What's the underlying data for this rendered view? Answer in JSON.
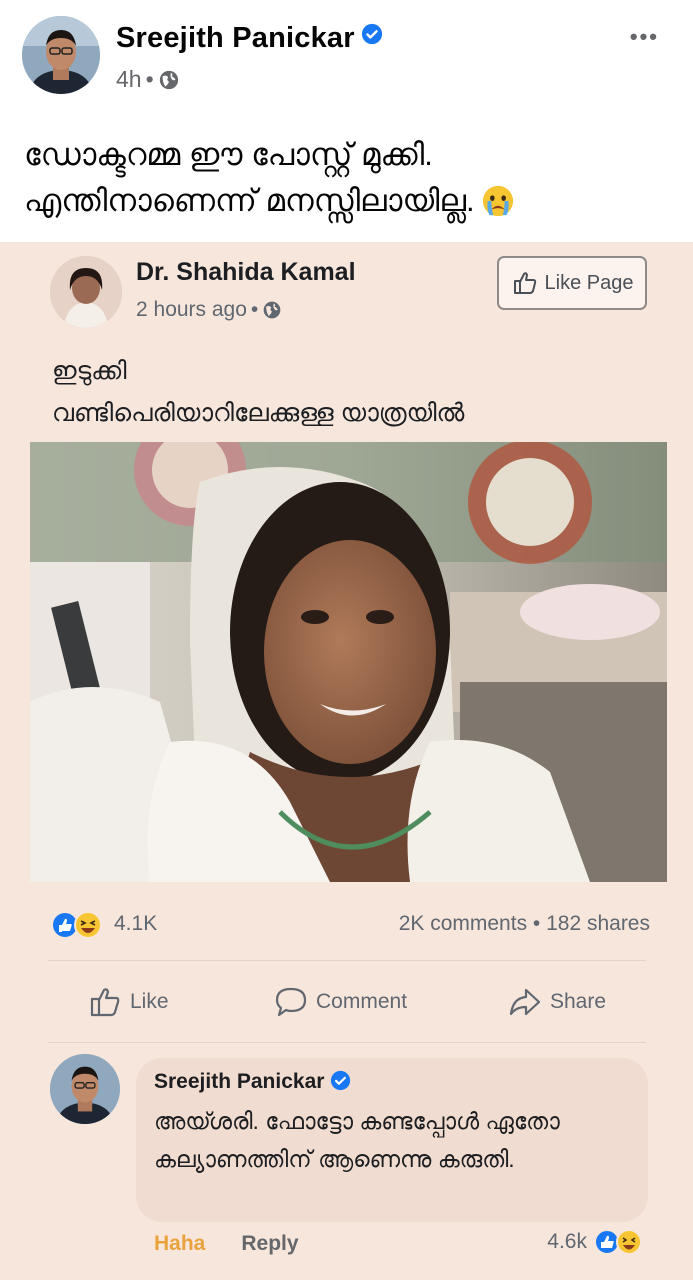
{
  "post": {
    "author": "Sreejith Panickar",
    "time": "4h",
    "separator": "•",
    "text_line1": "ഡോക്ടറമ്മ ഈ പോസ്റ്റ് മുക്കി.",
    "text_line2": "എന്തിനാണെന്ന് മനസ്സിലായില്ല."
  },
  "shared": {
    "author": "Dr. Shahida Kamal",
    "time": "2 hours ago",
    "separator": "•",
    "like_page_label": "Like Page",
    "text_line1": "ഇടുക്കി",
    "text_line2": "വണ്ടിപെരിയാറിലേക്കുള്ള യാത്രയിൽ",
    "reaction_count": "4.1K",
    "comments_shares": "2K comments • 182 shares",
    "actions": {
      "like": "Like",
      "comment": "Comment",
      "share": "Share"
    },
    "comment": {
      "author": "Sreejith Panickar",
      "text": "അയ്ശരി. ഫോട്ടോ കണ്ടപ്പോൾ ഏതോ കല്യാണത്തിന് ആണെന്നു കരുതി.",
      "haha_label": "Haha",
      "reply_label": "Reply",
      "reaction_count": "4.6k"
    }
  },
  "icons": {
    "verified": "verified-badge-icon",
    "globe": "globe-icon",
    "more": "more-options-icon",
    "emoji": "crying-face-emoji",
    "reactions": [
      "like-reaction-icon",
      "haha-reaction-icon"
    ]
  },
  "colors": {
    "verified_blue": "#1877f2",
    "panel_bg": "#f7e6dc",
    "haha_orange": "#e9a33c"
  }
}
